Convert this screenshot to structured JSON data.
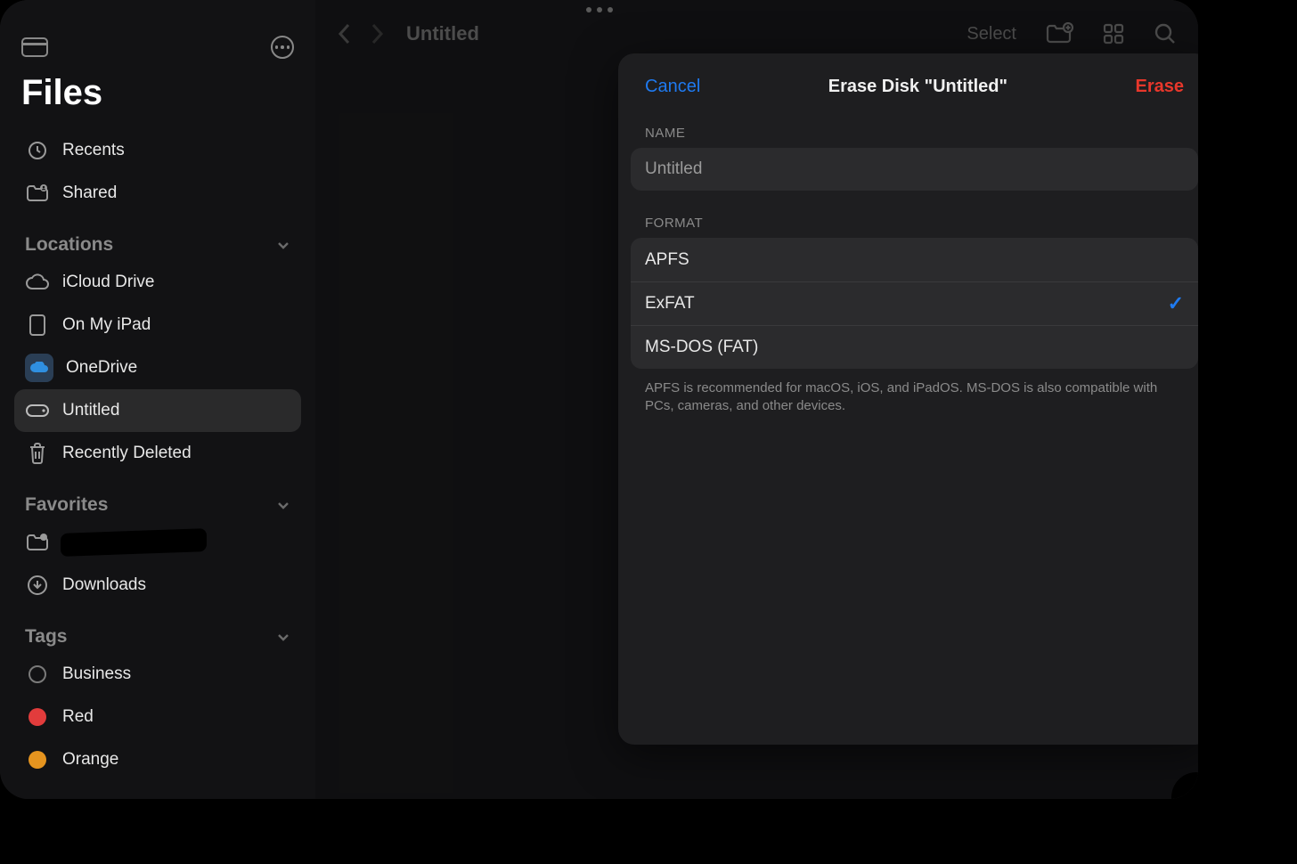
{
  "app_title": "Files",
  "toolbar": {
    "breadcrumb": "Untitled",
    "select_label": "Select"
  },
  "sidebar": {
    "recents": "Recents",
    "shared": "Shared",
    "sections": {
      "locations": "Locations",
      "favorites": "Favorites",
      "tags": "Tags"
    },
    "locations": {
      "icloud": "iCloud Drive",
      "onmyipad": "On My iPad",
      "onedrive": "OneDrive",
      "untitled": "Untitled",
      "recently_deleted": "Recently Deleted"
    },
    "favorites": {
      "redacted": "",
      "downloads": "Downloads"
    },
    "tags": {
      "business": "Business",
      "red": "Red",
      "orange": "Orange"
    }
  },
  "modal": {
    "cancel": "Cancel",
    "title": "Erase Disk \"Untitled\"",
    "erase": "Erase",
    "name_label": "NAME",
    "name_value": "Untitled",
    "format_label": "FORMAT",
    "formats": {
      "apfs": "APFS",
      "exfat": "ExFAT",
      "msdos": "MS-DOS (FAT)"
    },
    "selected_format": "exfat",
    "help": "APFS is recommended for macOS, iOS, and iPadOS. MS-DOS is also compatible with PCs, cameras, and other devices."
  },
  "colors": {
    "accent_blue": "#1f7af0",
    "destructive_red": "#e8372b",
    "tag_red": "#e23c3c",
    "tag_orange": "#e5941f"
  }
}
